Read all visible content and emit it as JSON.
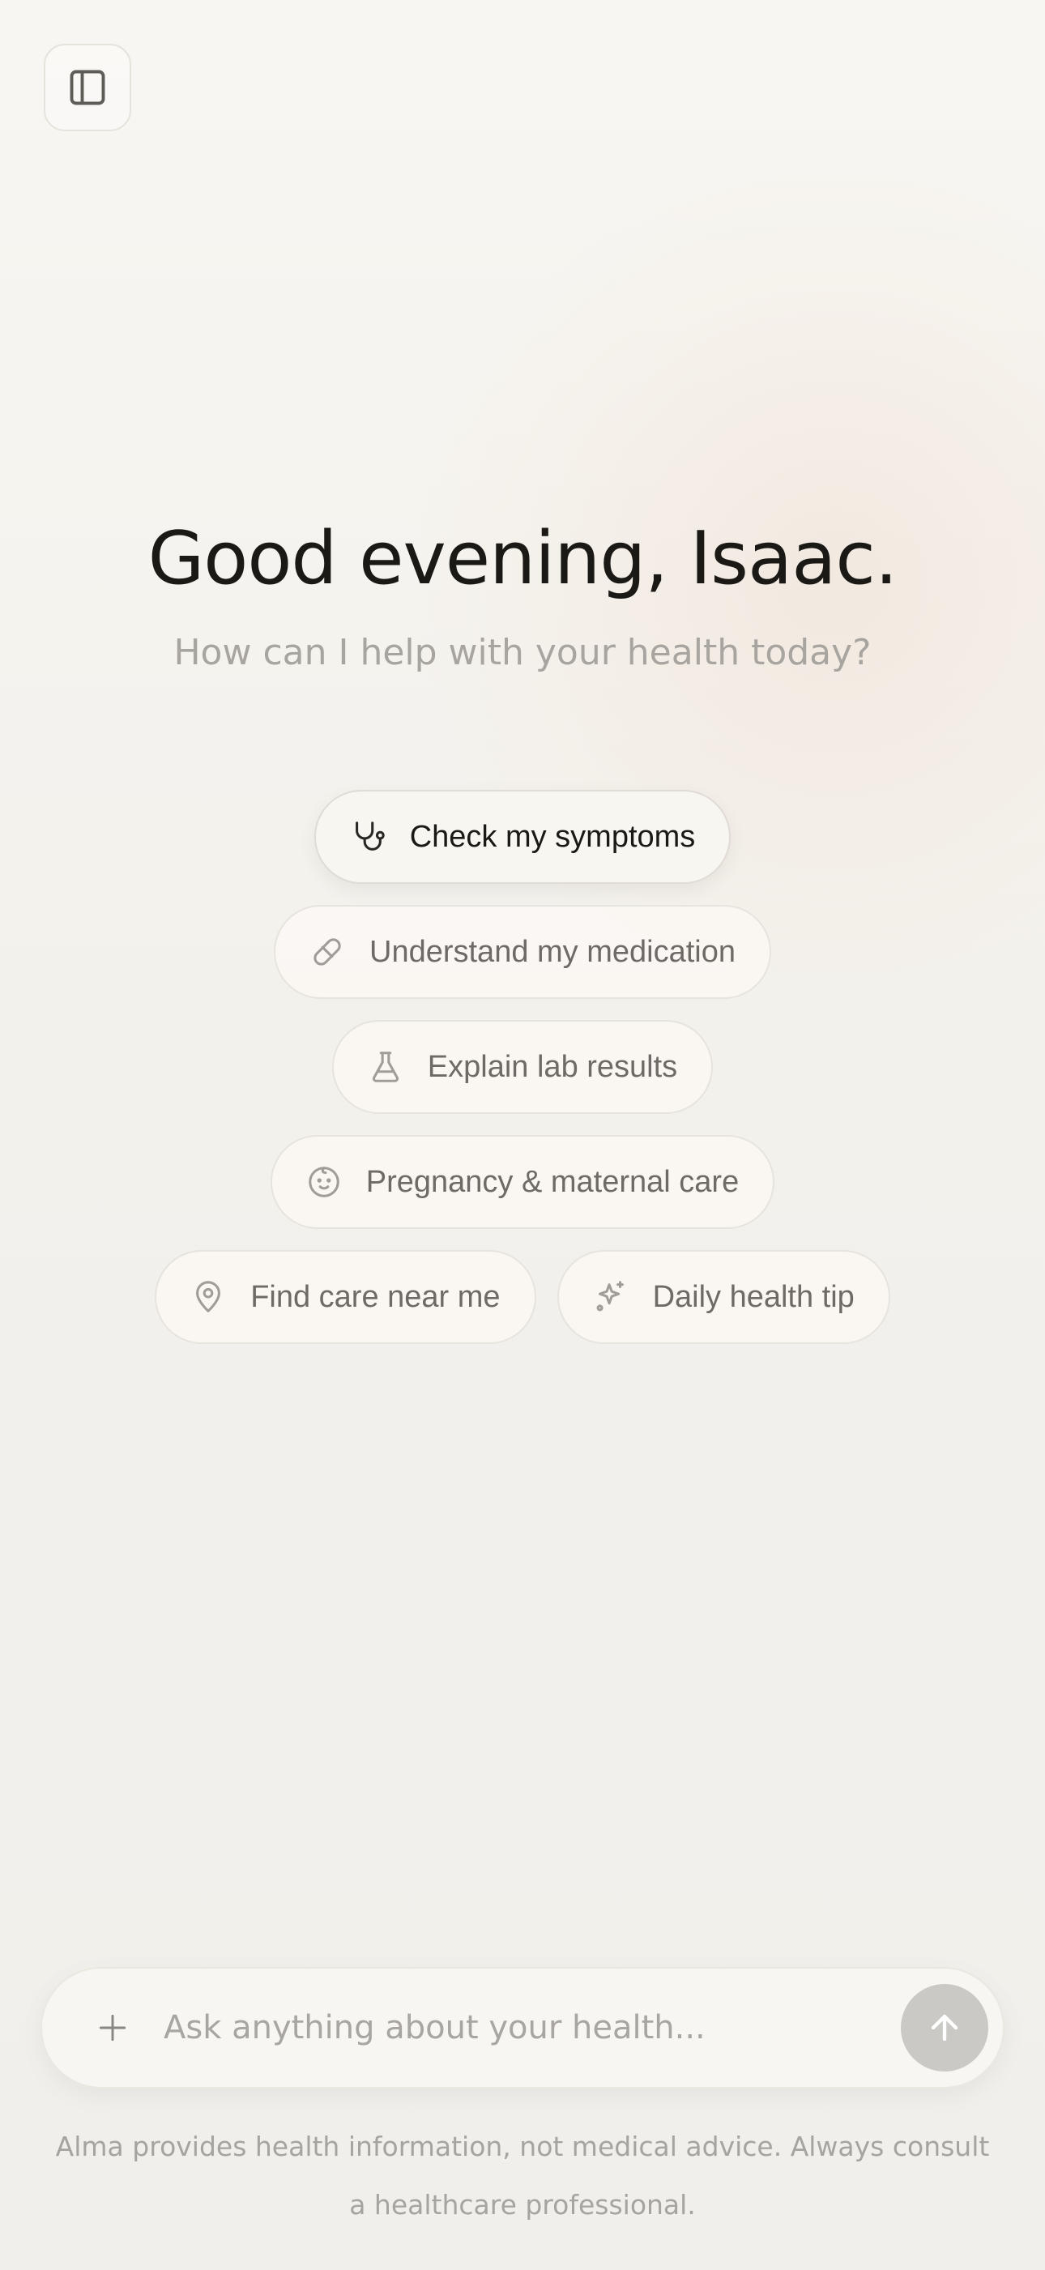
{
  "header": {
    "sidebar_icon": "sidebar-panel-icon"
  },
  "hero": {
    "greeting": "Good evening, Isaac.",
    "subtitle": "How can I help with your health today?"
  },
  "suggestions": [
    {
      "label": "Check my symptoms",
      "icon": "stethoscope-icon"
    },
    {
      "label": "Understand my medication",
      "icon": "pill-icon"
    },
    {
      "label": "Explain lab results",
      "icon": "flask-icon"
    },
    {
      "label": "Pregnancy & maternal care",
      "icon": "baby-face-icon"
    },
    {
      "label": "Find care near me",
      "icon": "map-pin-icon"
    },
    {
      "label": "Daily health tip",
      "icon": "sparkles-icon"
    }
  ],
  "composer": {
    "placeholder": "Ask anything about your health...",
    "value": "",
    "attach_icon": "plus-icon",
    "send_icon": "arrow-up-icon"
  },
  "disclaimer": "Alma provides health information, not medical advice. Always consult a healthcare professional.",
  "colors": {
    "text_primary": "#1b1916",
    "text_muted": "#a8a49f",
    "chip_text": "#6e6a66",
    "send_disabled": "#cbc9c6"
  }
}
